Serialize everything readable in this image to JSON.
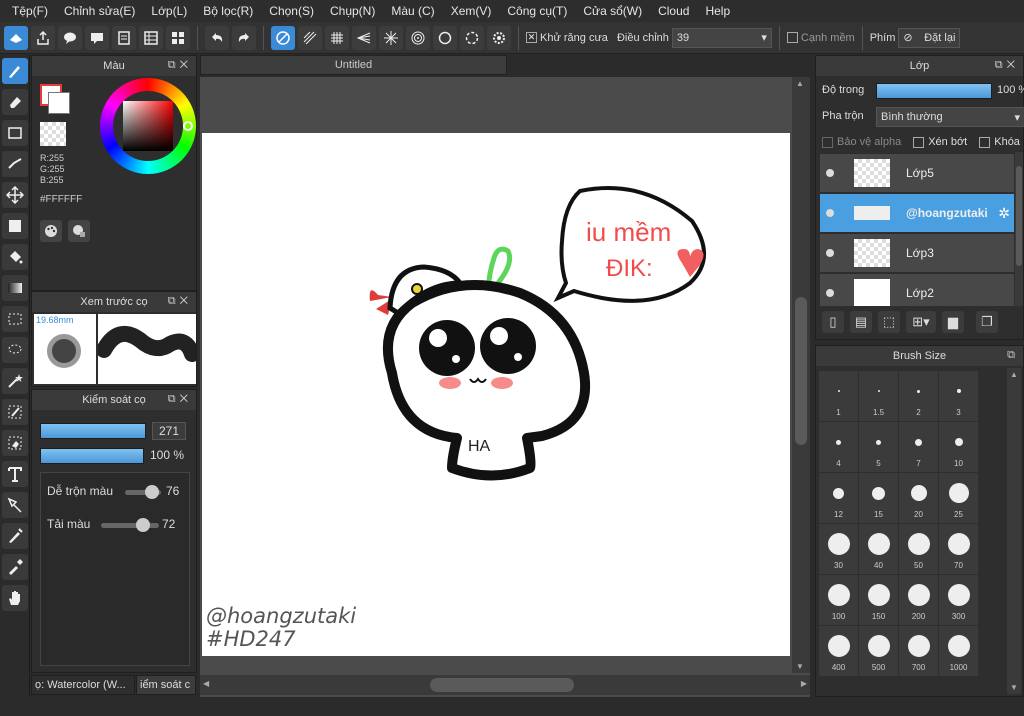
{
  "menu": [
    "Tệp(F)",
    "Chỉnh sửa(E)",
    "Lớp(L)",
    "Bộ lọc(R)",
    "Chọn(S)",
    "Chụp(N)",
    "Màu (C)",
    "Xem(V)",
    "Công cụ(T)",
    "Cửa sổ(W)",
    "Cloud",
    "Help"
  ],
  "toolbar": {
    "antialias_label": "Khử răng cưa",
    "adjust_label": "Điều chỉnh",
    "adjust_value": "39",
    "soft_edge_label": "Cạnh mềm",
    "key_label": "Phím",
    "reset_label": "Đặt lại"
  },
  "document": {
    "tab_title": "Untitled"
  },
  "color_panel": {
    "title": "Màu",
    "r": "R:255",
    "g": "G:255",
    "b": "B:255",
    "hex": "#FFFFFF"
  },
  "brush_preview": {
    "title": "Xem trước cọ",
    "size": "19.68mm"
  },
  "brush_control": {
    "title": "Kiểm soát cọ",
    "size_value": "271",
    "opacity_value": "100 %",
    "blend_label": "Dễ trộn màu",
    "blend_value": "76",
    "load_label": "Tải màu",
    "load_value": "72",
    "blend_level": 0.76,
    "load_level": 0.72
  },
  "bottom_tabs": [
    "ọ: Watercolor (W...",
    "iểm soát c"
  ],
  "canvas_art": {
    "bubble_line1": "iu mềm",
    "bubble_line2": "ĐIK:",
    "watermark1": "@hoangzutaki",
    "watermark2": "#HD247",
    "shirt_text": "HA"
  },
  "layers_panel": {
    "title": "Lớp",
    "opacity_label": "Độ trong",
    "opacity_value": "100 %",
    "blend_label": "Pha trộn",
    "blend_value": "Bình thường",
    "protect_alpha": "Bảo vệ alpha",
    "clipping": "Xén bớt",
    "lock": "Khóa",
    "layers": [
      {
        "name": "Lớp5",
        "selected": false
      },
      {
        "name": "@hoangzutaki",
        "selected": true
      },
      {
        "name": "Lớp3",
        "selected": false
      },
      {
        "name": "Lớp2",
        "selected": false
      }
    ]
  },
  "brush_size_panel": {
    "title": "Brush Size",
    "sizes": [
      "1",
      "1.5",
      "2",
      "3",
      "4",
      "5",
      "7",
      "10",
      "12",
      "15",
      "20",
      "25",
      "30",
      "40",
      "50",
      "70",
      "100",
      "150",
      "200",
      "300",
      "400",
      "500",
      "700",
      "1000"
    ]
  },
  "colors": {
    "accent": "#3a8ad6",
    "selected_layer": "#4a9fe0"
  }
}
